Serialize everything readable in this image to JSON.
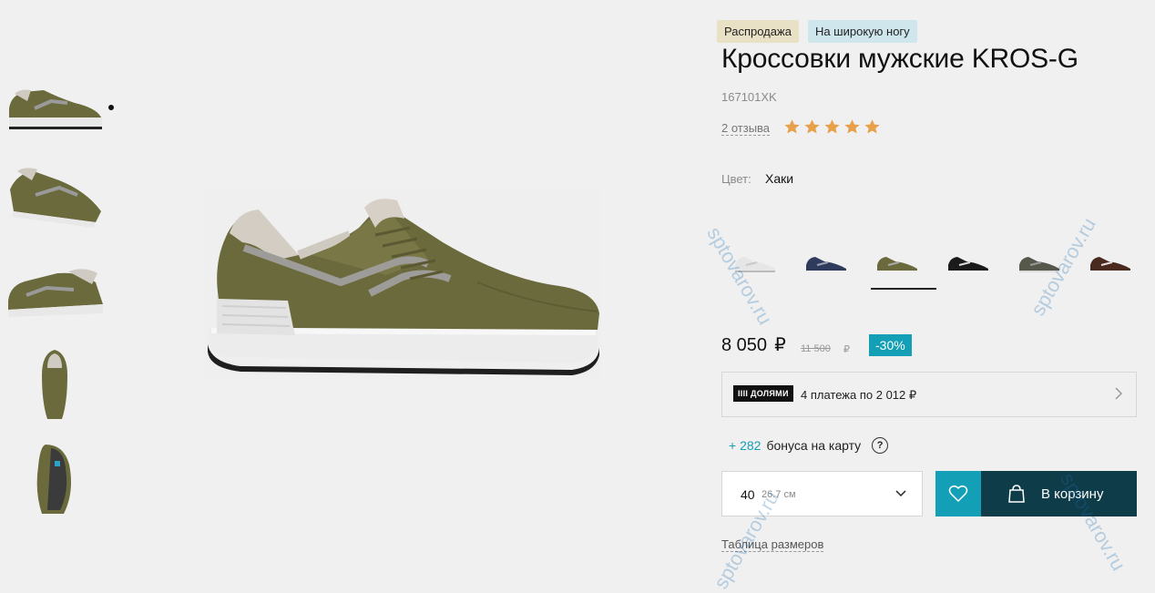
{
  "badges": {
    "sale": "Распродажа",
    "wide": "На широкую ногу"
  },
  "product": {
    "title": "Кроссовки мужские KROS-G",
    "sku": "167101XK",
    "reviews": "2 отзыва",
    "rating": 5
  },
  "color": {
    "label": "Цвет:",
    "value": "Хаки"
  },
  "variants": [
    "white",
    "navy",
    "khaki",
    "black",
    "grey-green",
    "brown"
  ],
  "price": {
    "current": "8 050",
    "currency": "₽",
    "old": "11 500",
    "old_currency": "₽",
    "discount": "-30%"
  },
  "dolyami": {
    "logo": "IIII ДОЛЯМИ",
    "text": "4 платежа по 2 012 ₽"
  },
  "bonus": {
    "amount": "+ 282",
    "text": "бонуса на карту",
    "help": "?"
  },
  "size": {
    "value": "40",
    "cm": "26.7 см"
  },
  "cart": {
    "label": "В корзину"
  },
  "size_table": "Таблица размеров",
  "watermark": "sptovarov.ru",
  "colors": {
    "accent": "#139fb5",
    "dark": "#0e3c48",
    "star": "#e8a04a",
    "khaki": "#6b6a3c"
  }
}
